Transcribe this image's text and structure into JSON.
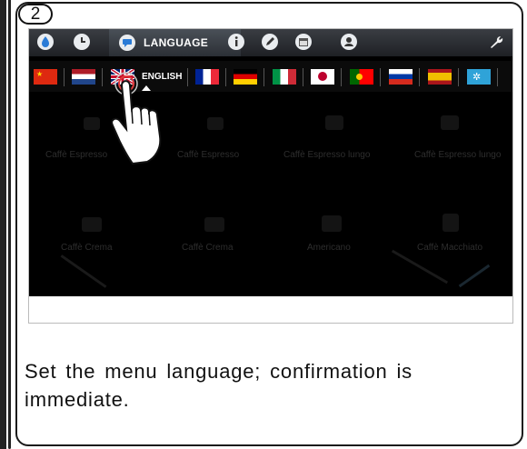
{
  "step": {
    "number": "2"
  },
  "topbar": {
    "tabs": [
      {
        "name": "drop",
        "icon": "drop-icon"
      },
      {
        "name": "clock",
        "icon": "clock-icon"
      },
      {
        "name": "language",
        "icon": "chat-icon",
        "label": "LANGUAGE",
        "active": true
      },
      {
        "name": "info",
        "icon": "info-icon"
      },
      {
        "name": "edit",
        "icon": "pencil-icon"
      },
      {
        "name": "calendar",
        "icon": "calendar-icon"
      },
      {
        "name": "user",
        "icon": "user-icon"
      },
      {
        "name": "service",
        "icon": "wrench-icon"
      }
    ],
    "accent": "#2a7bd6"
  },
  "flags": [
    {
      "name": "chinese",
      "icon": "flag-china"
    },
    {
      "name": "dutch",
      "icon": "flag-netherlands"
    },
    {
      "name": "english",
      "icon": "flag-uk",
      "label": "ENGLISH",
      "selected": true
    },
    {
      "name": "french",
      "icon": "flag-france"
    },
    {
      "name": "german",
      "icon": "flag-germany"
    },
    {
      "name": "italian",
      "icon": "flag-italy"
    },
    {
      "name": "japanese",
      "icon": "flag-japan"
    },
    {
      "name": "portuguese",
      "icon": "flag-portugal"
    },
    {
      "name": "russian",
      "icon": "flag-russia"
    },
    {
      "name": "spanish",
      "icon": "flag-spain"
    },
    {
      "name": "more",
      "icon": "flag-other"
    }
  ],
  "products": [
    {
      "label": "Caffè Espresso"
    },
    {
      "label": "Caffè Espresso"
    },
    {
      "label": "Caffè Espresso lungo"
    },
    {
      "label": "Caffè Espresso lungo"
    },
    {
      "label": "Caffè Crema"
    },
    {
      "label": "Caffè Crema"
    },
    {
      "label": "Americano"
    },
    {
      "label": "Caffè Macchiato"
    }
  ],
  "caption": "Set the menu language; confirmation is immediate."
}
